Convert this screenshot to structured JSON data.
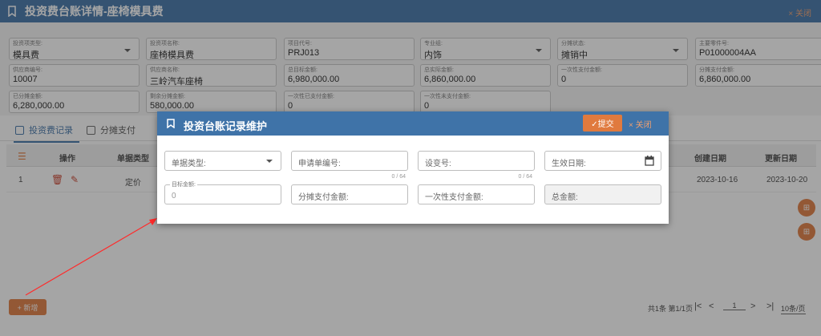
{
  "header": {
    "title": "投资费台账详情-座椅模具费",
    "close_label": "× 关闭"
  },
  "fields": [
    {
      "label": "投资项类型:",
      "value": "模具费",
      "dropdown": true
    },
    {
      "label": "投资项名称:",
      "value": "座椅模具费"
    },
    {
      "label": "项目代号:",
      "value": "PRJ013"
    },
    {
      "label": "专业组:",
      "value": "内饰",
      "dropdown": true
    },
    {
      "label": "分摊状态:",
      "value": "摊销中",
      "dropdown": true
    },
    {
      "label": "主要零件号:",
      "value": "P01000004AA"
    },
    {
      "label": "供应商编号:",
      "value": "10007"
    },
    {
      "label": "供应商名称:",
      "value": "三岭汽车座椅"
    },
    {
      "label": "总目标金额:",
      "value": "6,980,000.00"
    },
    {
      "label": "总实际金额:",
      "value": "6,860,000.00"
    },
    {
      "label": "一次性支付金额:",
      "value": "0"
    },
    {
      "label": "分摊支付金额:",
      "value": "6,860,000.00"
    },
    {
      "label": "已分摊金额:",
      "value": "6,280,000.00"
    },
    {
      "label": "剩余分摊金额:",
      "value": "580,000.00"
    },
    {
      "label": "一次性已支付金额:",
      "value": "0"
    },
    {
      "label": "一次性未支付金额:",
      "value": "0"
    }
  ],
  "tabs": [
    {
      "label": "投资费记录"
    },
    {
      "label": "分摊支付"
    }
  ],
  "table": {
    "headers": {
      "op": "操作",
      "type": "单据类型",
      "created": "创建日期",
      "updated": "更新日期"
    },
    "row": {
      "index": "1",
      "type": "定价",
      "created": "2023-10-16",
      "updated": "2023-10-20"
    }
  },
  "add_label": "+ 新增",
  "pager": {
    "summary": "共1条 第1/1页",
    "page": "1",
    "page_size": "10条/页"
  },
  "modal": {
    "title": "投资台账记录维护",
    "submit_label": "✓提交",
    "close_label": "× 关闭",
    "fields": {
      "doc_type": "单据类型:",
      "apply_no": "申请单编号:",
      "apply_count": "0 / 64",
      "change_no": "设变号:",
      "change_count": "0 / 64",
      "effective_date": "生效日期:",
      "target_label": "目标金额:",
      "target_value": "0",
      "allocated": "分摊支付金额:",
      "one_time": "一次性支付金额:",
      "total": "总金额:"
    }
  },
  "colors": {
    "primary": "#3f73a8",
    "accent": "#e07a3e"
  }
}
